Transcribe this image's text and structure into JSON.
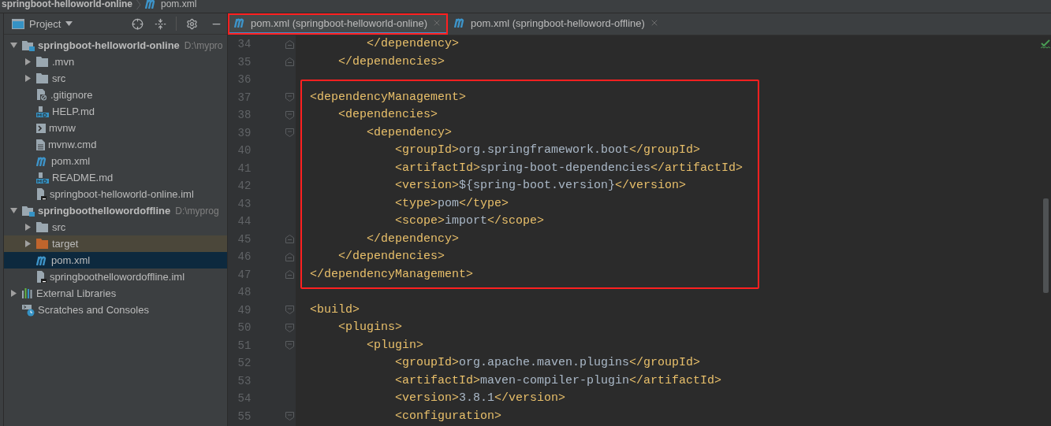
{
  "breadcrumb": {
    "project": "springboot-helloworld-online",
    "file": "pom.xml"
  },
  "project_panel": {
    "title": "Project",
    "tree": [
      {
        "label": "springboot-helloworld-online",
        "hint": "D:\\mypro",
        "kind": "module",
        "expanded": true,
        "selected": false,
        "children": [
          {
            "label": ".mvn",
            "kind": "folder",
            "expanded": false,
            "selected": false
          },
          {
            "label": "src",
            "kind": "folder",
            "expanded": false,
            "selected": false
          },
          {
            "label": ".gitignore",
            "kind": "ignore",
            "selected": false
          },
          {
            "label": "HELP.md",
            "kind": "markdown",
            "selected": false
          },
          {
            "label": "mvnw",
            "kind": "script",
            "selected": false
          },
          {
            "label": "mvnw.cmd",
            "kind": "text",
            "selected": false
          },
          {
            "label": "pom.xml",
            "kind": "maven",
            "selected": false
          },
          {
            "label": "README.md",
            "kind": "markdown",
            "selected": false
          },
          {
            "label": "springboot-helloworld-online.iml",
            "kind": "iml",
            "selected": false
          }
        ]
      },
      {
        "label": "springboothellowordoffline",
        "hint": "D:\\myprog",
        "kind": "module",
        "expanded": true,
        "selected": false,
        "children": [
          {
            "label": "src",
            "kind": "folder",
            "expanded": false,
            "selected": false
          },
          {
            "label": "target",
            "kind": "excluded",
            "expanded": false,
            "selected": false
          },
          {
            "label": "pom.xml",
            "kind": "maven",
            "selected": true
          },
          {
            "label": "springboothellowordoffline.iml",
            "kind": "iml",
            "selected": false
          }
        ]
      },
      {
        "label": "External Libraries",
        "kind": "libraries",
        "expanded": false,
        "selected": false
      },
      {
        "label": "Scratches and Consoles",
        "kind": "scratches",
        "selected": false
      }
    ]
  },
  "tabs": [
    {
      "label": "pom.xml (springboot-helloworld-online)",
      "selected": true,
      "highlighted": true
    },
    {
      "label": "pom.xml (springboot-helloword-offline)",
      "selected": false,
      "highlighted": false
    }
  ],
  "code": [
    {
      "highlighted": false,
      "lines": [
        {
          "number": "34",
          "fold_end": true,
          "tokens": [
            {
              "kind": "tag",
              "text": "        </dependency>"
            }
          ]
        },
        {
          "number": "35",
          "fold_end": true,
          "tokens": [
            {
              "kind": "tag",
              "text": "    </dependencies>"
            }
          ]
        },
        {
          "number": "36"
        }
      ]
    },
    {
      "highlighted": true,
      "lines": [
        {
          "number": "37",
          "fold_start": true,
          "tokens": [
            {
              "kind": "tag",
              "text": "<dependencyManagement>"
            }
          ]
        },
        {
          "number": "38",
          "fold_start": true,
          "tokens": [
            {
              "kind": "tag",
              "text": "    <dependencies>"
            }
          ]
        },
        {
          "number": "39",
          "fold_start": true,
          "tokens": [
            {
              "kind": "tag",
              "text": "        <dependency>"
            }
          ]
        },
        {
          "number": "40",
          "tokens": [
            {
              "kind": "tag",
              "text": "            <groupId>"
            },
            {
              "kind": "value",
              "text": "org.springframework.boot"
            },
            {
              "kind": "tag",
              "text": "</groupId>"
            }
          ]
        },
        {
          "number": "41",
          "tokens": [
            {
              "kind": "tag",
              "text": "            <artifactId>"
            },
            {
              "kind": "value",
              "text": "spring-boot-dependencies"
            },
            {
              "kind": "tag",
              "text": "</artifactId>"
            }
          ]
        },
        {
          "number": "42",
          "tokens": [
            {
              "kind": "tag",
              "text": "            <version>"
            },
            {
              "kind": "value",
              "text": "${spring-boot.version}"
            },
            {
              "kind": "tag",
              "text": "</version>"
            }
          ]
        },
        {
          "number": "43",
          "tokens": [
            {
              "kind": "tag",
              "text": "            <type>"
            },
            {
              "kind": "value",
              "text": "pom"
            },
            {
              "kind": "tag",
              "text": "</type>"
            }
          ]
        },
        {
          "number": "44",
          "tokens": [
            {
              "kind": "tag",
              "text": "            <scope>"
            },
            {
              "kind": "value",
              "text": "import"
            },
            {
              "kind": "tag",
              "text": "</scope>"
            }
          ]
        },
        {
          "number": "45",
          "fold_end": true,
          "tokens": [
            {
              "kind": "tag",
              "text": "        </dependency>"
            }
          ]
        },
        {
          "number": "46",
          "fold_end": true,
          "tokens": [
            {
              "kind": "tag",
              "text": "    </dependencies>"
            }
          ]
        },
        {
          "number": "47",
          "fold_end": true,
          "tokens": [
            {
              "kind": "tag",
              "text": "</dependencyManagement>"
            }
          ]
        }
      ]
    },
    {
      "highlighted": false,
      "lines": [
        {
          "number": "48"
        },
        {
          "number": "49",
          "fold_start": true,
          "tokens": [
            {
              "kind": "tag",
              "text": "<build>"
            }
          ]
        },
        {
          "number": "50",
          "fold_start": true,
          "tokens": [
            {
              "kind": "tag",
              "text": "    <plugins>"
            }
          ]
        },
        {
          "number": "51",
          "fold_start": true,
          "tokens": [
            {
              "kind": "tag",
              "text": "        <plugin>"
            }
          ]
        },
        {
          "number": "52",
          "tokens": [
            {
              "kind": "tag",
              "text": "            <groupId>"
            },
            {
              "kind": "value",
              "text": "org.apache.maven.plugins"
            },
            {
              "kind": "tag",
              "text": "</groupId>"
            }
          ]
        },
        {
          "number": "53",
          "tokens": [
            {
              "kind": "tag",
              "text": "            <artifactId>"
            },
            {
              "kind": "value",
              "text": "maven-compiler-plugin"
            },
            {
              "kind": "tag",
              "text": "</artifactId>"
            }
          ]
        },
        {
          "number": "54",
          "tokens": [
            {
              "kind": "tag",
              "text": "            <version>"
            },
            {
              "kind": "value",
              "text": "3.8.1"
            },
            {
              "kind": "tag",
              "text": "</version>"
            }
          ]
        },
        {
          "number": "55",
          "fold_start": true,
          "tokens": [
            {
              "kind": "tag",
              "text": "            <configuration>"
            }
          ]
        }
      ]
    }
  ]
}
